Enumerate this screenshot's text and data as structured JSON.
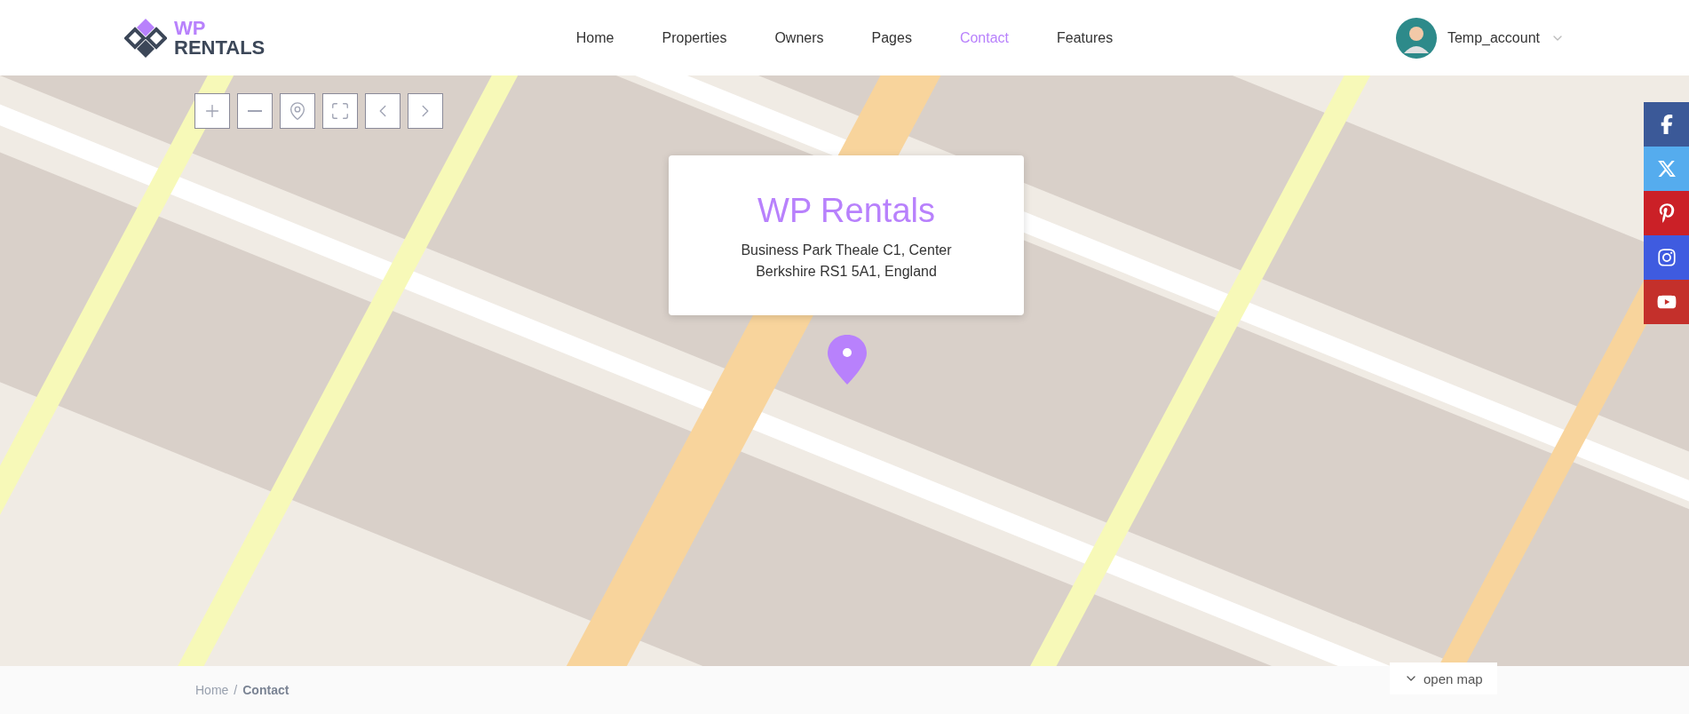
{
  "logo": {
    "top": "WP",
    "bottom": "RENTALS"
  },
  "nav": [
    {
      "label": "Home",
      "selected": false
    },
    {
      "label": "Properties",
      "selected": false
    },
    {
      "label": "Owners",
      "selected": false
    },
    {
      "label": "Pages",
      "selected": false
    },
    {
      "label": "Contact",
      "selected": true
    },
    {
      "label": "Features",
      "selected": false
    }
  ],
  "account": {
    "name": "Temp_account"
  },
  "map_controls": [
    {
      "kind": "zoom-in"
    },
    {
      "kind": "zoom-out"
    },
    {
      "kind": "locate"
    },
    {
      "kind": "fullscreen"
    },
    {
      "kind": "prev"
    },
    {
      "kind": "next"
    }
  ],
  "popup": {
    "title": "WP Rentals",
    "lines": [
      "Business Park Theale C1, Center",
      "Berkshire RS1 5A1, England"
    ]
  },
  "social": [
    {
      "kind": "facebook",
      "color": "#3b5998"
    },
    {
      "kind": "x",
      "color": "#55acee"
    },
    {
      "kind": "pinterest",
      "color": "#cb2027"
    },
    {
      "kind": "instagram",
      "color": "#3f5be0"
    },
    {
      "kind": "youtube",
      "color": "#c4302b"
    }
  ],
  "breadcrumb_separator": "/",
  "breadcrumb": [
    {
      "label": "Home",
      "selected": false
    },
    {
      "label": "Contact",
      "selected": true
    }
  ],
  "open_map": {
    "label": "open map"
  }
}
